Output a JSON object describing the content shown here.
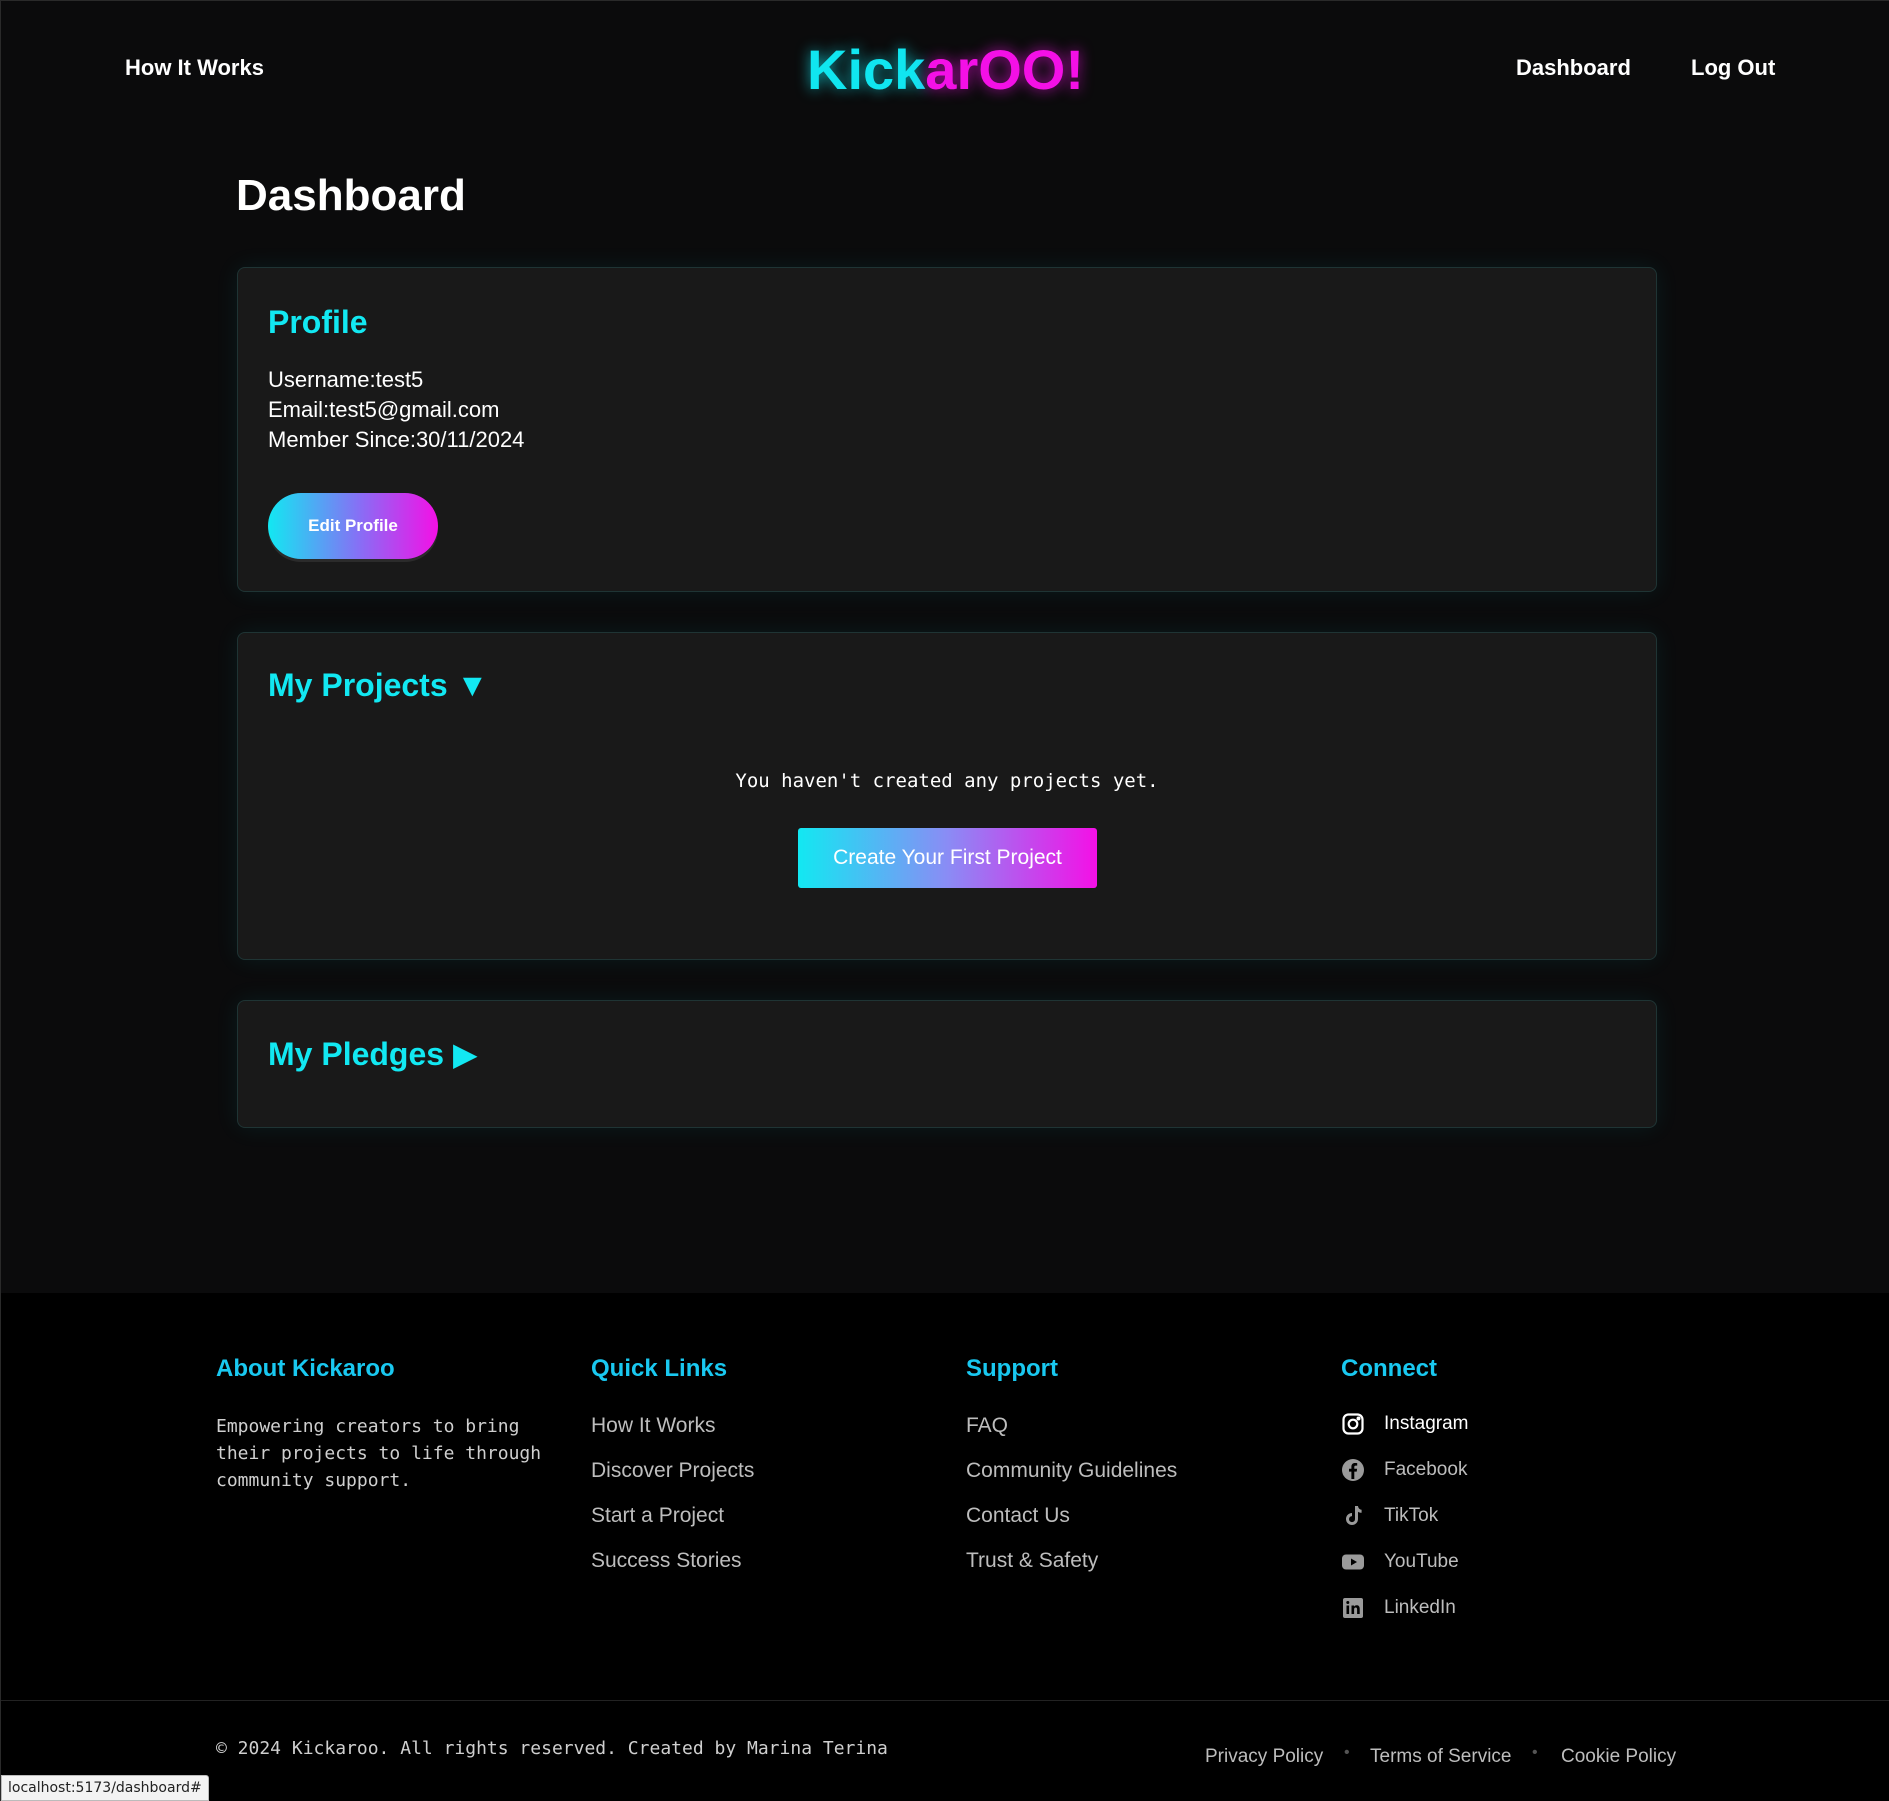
{
  "header": {
    "nav_how_it_works": "How It Works",
    "logo_part1": "Kick",
    "logo_part2": "arOO!",
    "nav_dashboard": "Dashboard",
    "nav_logout": "Log Out"
  },
  "page_title": "Dashboard",
  "profile": {
    "title": "Profile",
    "username": "Username:test5",
    "email": "Email:test5@gmail.com",
    "member_since": "Member Since:30/11/2024",
    "edit_button": "Edit Profile"
  },
  "projects": {
    "title": "My Projects ▼",
    "empty_text": "You haven't created any projects yet.",
    "create_button": "Create Your First Project"
  },
  "pledges": {
    "title": "My Pledges ▶"
  },
  "footer": {
    "about_title": "About Kickaroo",
    "about_text": "Empowering creators to bring their projects to life through community support.",
    "quick_title": "Quick Links",
    "quick_links": [
      "How It Works",
      "Discover Projects",
      "Start a Project",
      "Success Stories"
    ],
    "support_title": "Support",
    "support_links": [
      "FAQ",
      "Community Guidelines",
      "Contact Us",
      "Trust & Safety"
    ],
    "connect_title": "Connect",
    "social": [
      {
        "label": "Instagram",
        "icon": "instagram-icon"
      },
      {
        "label": "Facebook",
        "icon": "facebook-icon"
      },
      {
        "label": "TikTok",
        "icon": "tiktok-icon"
      },
      {
        "label": "YouTube",
        "icon": "youtube-icon"
      },
      {
        "label": "LinkedIn",
        "icon": "linkedin-icon"
      }
    ],
    "copyright": "© 2024 Kickaroo. All rights reserved. Created by Marina Terina",
    "legal": [
      "Privacy Policy",
      "Terms of Service",
      "Cookie Policy"
    ]
  },
  "status_url": "localhost:5173/dashboard#",
  "colors": {
    "accent_cyan": "#12e8f2",
    "accent_magenta": "#f410e6",
    "background": "#0b0b0c",
    "card": "#191919"
  }
}
